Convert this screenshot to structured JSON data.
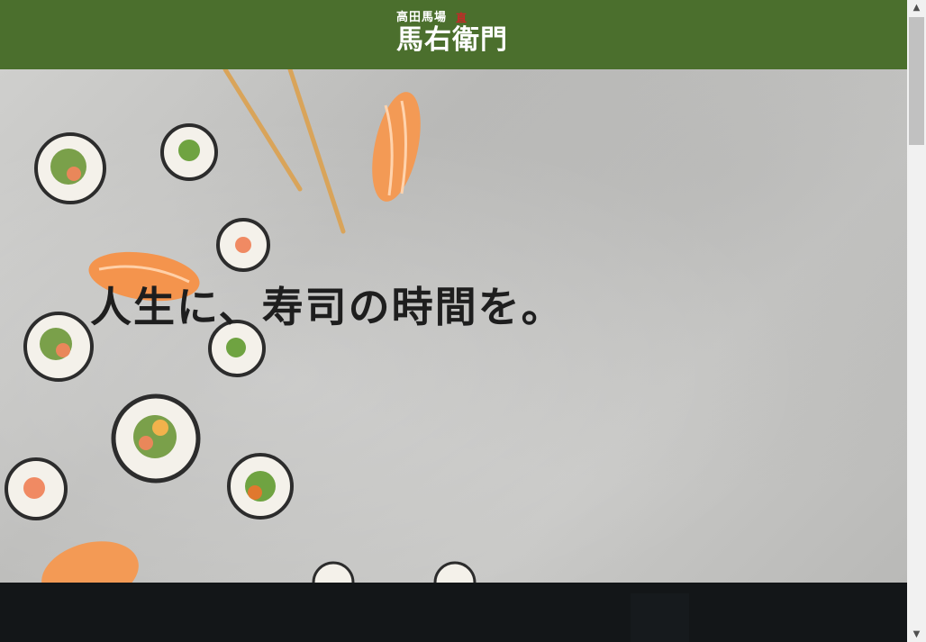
{
  "header": {
    "logo_sub": "高田馬場",
    "logo_seal": "直",
    "logo_main": "馬右衛門"
  },
  "hero": {
    "tagline": "人生に、寿司の時間を。"
  },
  "colors": {
    "header_bg": "#4b6f2d",
    "dark_band": "#131618",
    "tagline": "#1e1e1e"
  },
  "scrollbar": {
    "up_icon": "triangle-up-icon",
    "down_icon": "triangle-down-icon"
  }
}
